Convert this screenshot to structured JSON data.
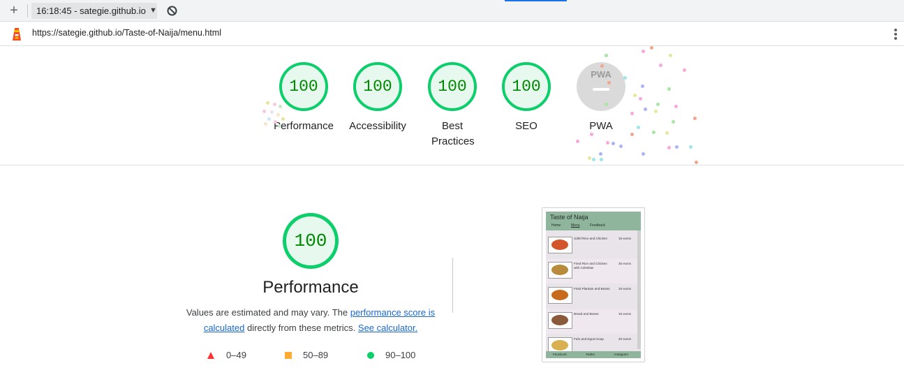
{
  "toolbar": {
    "report_selector": "16:18:45 - sategie.github.io",
    "url": "https://sategie.github.io/Taste-of-Naija/menu.html"
  },
  "categories": [
    {
      "name": "performance",
      "score": "100",
      "label": "Performance"
    },
    {
      "name": "accessibility",
      "score": "100",
      "label": "Accessibility"
    },
    {
      "name": "best-practices",
      "score": "100",
      "label": "Best Practices"
    },
    {
      "name": "seo",
      "score": "100",
      "label": "SEO"
    },
    {
      "name": "pwa",
      "score": "",
      "label": "PWA"
    }
  ],
  "pwa_badge_text": "PWA",
  "performance_section": {
    "score": "100",
    "title": "Performance",
    "desc_before": "Values are estimated and may vary. The ",
    "link_score": "performance score is calculated",
    "desc_middle": " directly from these metrics. ",
    "link_calc": "See calculator."
  },
  "legend": [
    {
      "range": "0–49",
      "color": "#ff3333",
      "shape": "triangle"
    },
    {
      "range": "50–89",
      "color": "#ffaa33",
      "shape": "square"
    },
    {
      "range": "90–100",
      "color": "#0cce6b",
      "shape": "circle"
    }
  ],
  "colors": {
    "pass_green": "#0cce6b",
    "pass_text": "#008800",
    "pass_fill": "#e7f8ee",
    "link": "#1967d2",
    "tab_accent": "#1a73e8"
  },
  "page_screenshot": {
    "site_title": "Taste of Naija",
    "nav": [
      "Home",
      "Menu",
      "Feedback"
    ],
    "items": [
      {
        "name": "Jollof Rice and Chicken",
        "price": "15 euros"
      },
      {
        "name": "Fried Rice and Chicken with Coleslaw",
        "price": "25 euros"
      },
      {
        "name": "Fried Plantain and Beans",
        "price": "15 euros"
      },
      {
        "name": "Bread and Beans",
        "price": "15 euros"
      },
      {
        "name": "Fufu and Egusi Soup",
        "price": "20 euros"
      }
    ],
    "footer": [
      "Facebook",
      "Twitter",
      "Instagram"
    ]
  }
}
